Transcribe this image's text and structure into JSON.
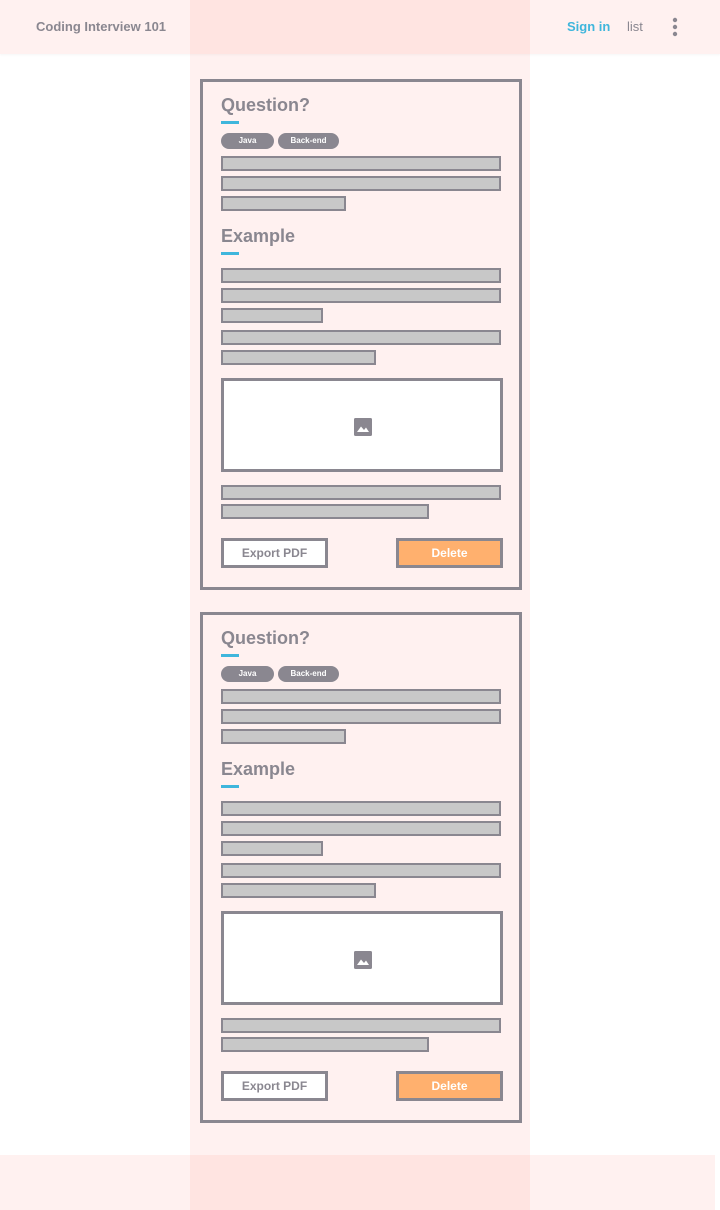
{
  "header": {
    "app_title": "Coding Interview 101",
    "sign_in_label": "Sign in",
    "list_label": "list",
    "more_icon": "more-vertical-icon"
  },
  "colors": {
    "accent": "#3fb6dc",
    "delete_button": "#ffb06e",
    "text_gray": "#8a8790",
    "placeholder_bar": "#c8c8c8",
    "page_tint": "#fff1f0"
  },
  "cards": [
    {
      "question_heading": "Question?",
      "tags": [
        "Java",
        "Back-end"
      ],
      "example_heading": "Example",
      "image_icon": "image-icon",
      "export_label": "Export PDF",
      "delete_label": "Delete"
    },
    {
      "question_heading": "Question?",
      "tags": [
        "Java",
        "Back-end"
      ],
      "example_heading": "Example",
      "image_icon": "image-icon",
      "export_label": "Export PDF",
      "delete_label": "Delete"
    }
  ]
}
